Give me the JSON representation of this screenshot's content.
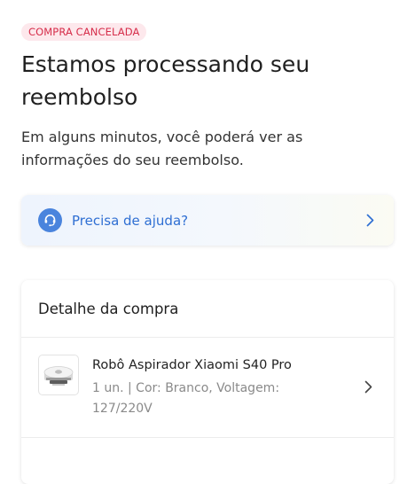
{
  "status_badge": "COMPRA CANCELADA",
  "title": "Estamos processando seu reembolso",
  "subtitle": "Em alguns minutos, você poderá ver as informações do seu reembolso.",
  "help": {
    "label": "Precisa de ajuda?",
    "icon": "headset-icon",
    "chevron": "chevron-right-icon"
  },
  "detail": {
    "title": "Detalhe da compra",
    "product": {
      "name": "Robô Aspirador Xiaomi S40 Pro",
      "details": "1 un. | Cor: Branco, Voltagem: 127/220V",
      "image": "robot-vacuum-image"
    }
  },
  "colors": {
    "badge_background": "#fde8ec",
    "badge_text": "#d62d4a",
    "accent_blue": "#2f6fd3",
    "help_icon_background": "#4a84dd"
  }
}
